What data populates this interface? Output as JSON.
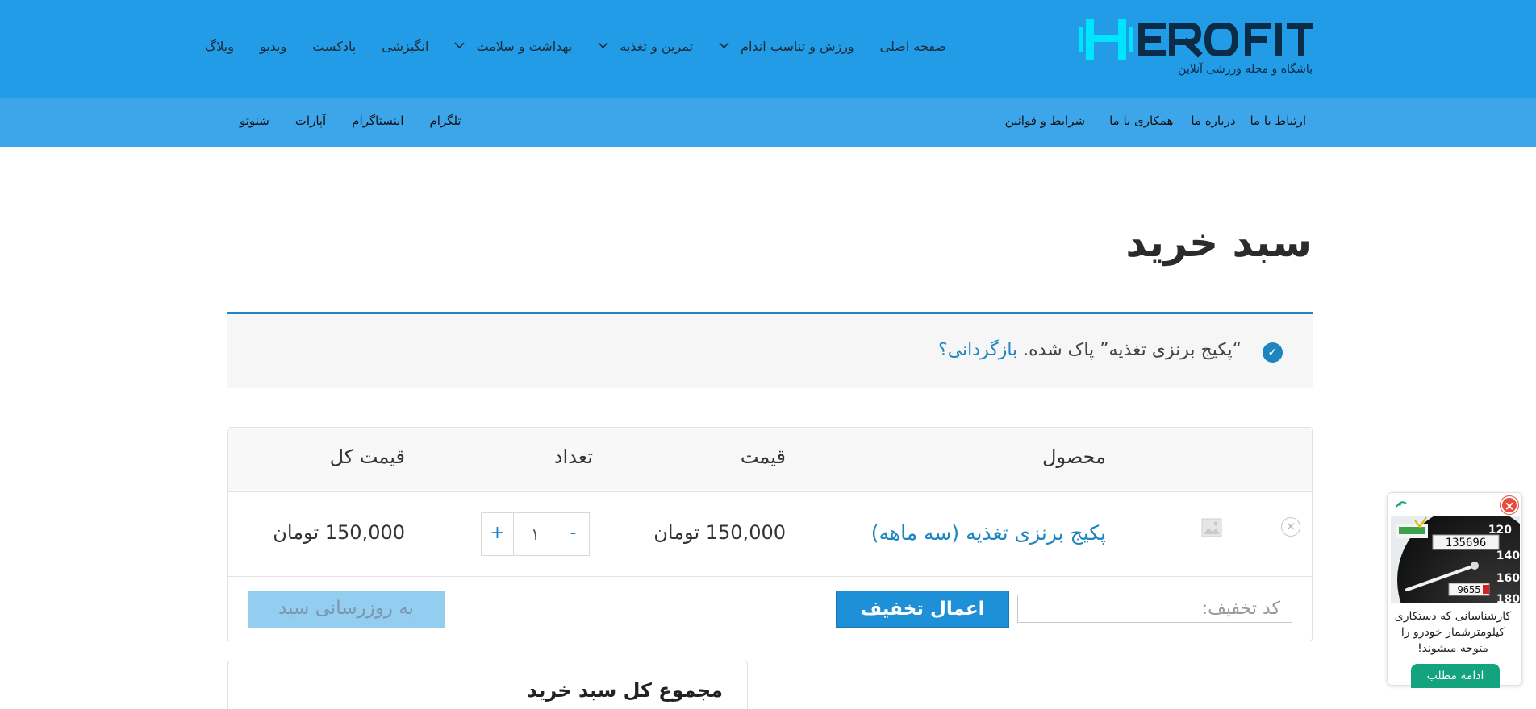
{
  "header": {
    "logo_alt": "HeroFit",
    "logo_tagline": "باشگاه و مجله ورزشی آنلاین",
    "nav": [
      {
        "label": "صفحه اصلی",
        "has_dropdown": false
      },
      {
        "label": "ورزش و تناسب اندام",
        "has_dropdown": true
      },
      {
        "label": "تمرین و تغذیه",
        "has_dropdown": true
      },
      {
        "label": "بهداشت و سلامت",
        "has_dropdown": true
      },
      {
        "label": "انگیزشی",
        "has_dropdown": false
      },
      {
        "label": "پادکست",
        "has_dropdown": false
      },
      {
        "label": "ویدیو",
        "has_dropdown": false
      },
      {
        "label": "ویلاگ",
        "has_dropdown": false
      }
    ]
  },
  "subnav": {
    "right": [
      "ارتباط با ما",
      "درباره ما",
      "همکاری با ما",
      "شرایط و قوانین"
    ],
    "left": [
      "تلگرام",
      "اینستاگرام",
      "آپارات",
      "شنوتو"
    ]
  },
  "page": {
    "title": "سبد خرید"
  },
  "notice": {
    "message": "“پکیج برنزی تغذیه” پاک شده.",
    "undo_label": "بازگردانی؟"
  },
  "cart": {
    "headers": {
      "product": "محصول",
      "price": "قیمت",
      "quantity": "تعداد",
      "subtotal": "قیمت کل"
    },
    "items": [
      {
        "name": "پکیج برنزی تغذیه (سه ماهه)",
        "price": "150,000 تومان",
        "quantity": "۱",
        "subtotal": "150,000 تومان"
      }
    ],
    "remove_symbol": "×",
    "qty_plus": "+",
    "qty_minus": "-",
    "coupon_placeholder": "کد تخفیف:",
    "apply_coupon_label": "اعمال تخفیف",
    "update_cart_label": "به روزرسانی سبد"
  },
  "totals": {
    "title": "مجموع کل سبد خرید"
  },
  "ad": {
    "close_symbol": "×",
    "text": "کارشناسانی که دستکاری کیلومترشمار خودرو را متوجه میشوند!",
    "cta_label": "ادامه مطلب",
    "odometer_digits": "135696",
    "trip_digits": "9655",
    "dial_numbers": [
      "120",
      "140",
      "160",
      "180"
    ]
  },
  "colors": {
    "header_bg": "#239ce8",
    "subbar_bg": "#3da6eb",
    "accent": "#1e85be",
    "button_primary": "#1e90d8",
    "button_disabled": "#93cdef",
    "ad_green": "#14a37f",
    "logo_cyan": "#00e5ff"
  }
}
